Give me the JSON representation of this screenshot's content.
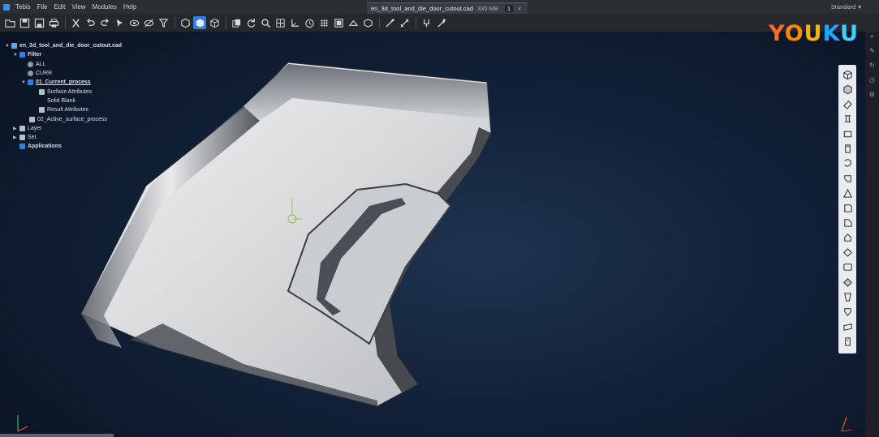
{
  "menubar": {
    "items": [
      "Tebis",
      "File",
      "Edit",
      "View",
      "Modules",
      "Help"
    ]
  },
  "document_tab": {
    "filename": "en_3d_tool_and_die_door_cutout.cad",
    "memory": "330 MB",
    "badge": "1",
    "close": "×"
  },
  "workspace": {
    "label": "Standard"
  },
  "toolbar_icons": [
    "open-file-icon",
    "save-icon",
    "save-as-icon",
    "print-icon",
    "print-preview-icon",
    "cut-icon",
    "undo-icon",
    "redo-icon",
    "visibility-icon",
    "hide-icon",
    "filter-icon",
    "view-cube-icon",
    "shaded-view-icon",
    "wireframe-view-icon",
    "copy-icon",
    "refresh-icon",
    "zoom-icon",
    "fit-icon",
    "coordinate-system-icon",
    "clock-icon",
    "grid-icon",
    "frame-icon",
    "split-view-icon",
    "box-view-icon",
    "pick-icon",
    "measure-icon",
    "paint-icon",
    "tools-icon"
  ],
  "tree": {
    "root": "en_3d_tool_and_die_door_cutout.cad",
    "filter": "Filter",
    "all": "ALL",
    "curr": "CURR",
    "current_process": "01_Current_process",
    "surface_attributes": "Surface Attributes",
    "solid_blank": "Solid Blank",
    "result_attributes": "Result Attributes",
    "active_surface_process": "02_Active_surface_process",
    "layer": "Layer",
    "set": "Set",
    "applications": "Applications"
  },
  "logo": {
    "letters": [
      "Y",
      "O",
      "U",
      "K",
      "U"
    ]
  },
  "right_toolbar_icons": [
    "box-icon",
    "cube-icon",
    "extrude-icon",
    "profile-icon",
    "rectangle-icon",
    "cylinder-icon",
    "revolve-icon",
    "shell-icon",
    "blend-icon",
    "fillet-icon",
    "chamfer-icon",
    "offset-icon",
    "face-icon",
    "square-icon",
    "sweep-icon",
    "loft-icon",
    "draft-icon",
    "plane-icon",
    "trim-icon"
  ],
  "edge_icons": [
    "collapse-icon",
    "edit-icon",
    "refresh-icon",
    "clock-icon",
    "settings-icon"
  ],
  "colors": {
    "accent": "#2f7fe0",
    "menubar": "#2b2e33",
    "viewport_center": "#1e3450",
    "viewport_edge": "#0a1424",
    "part_light": "#e4e6e8",
    "part_dark": "#2a2e33"
  }
}
